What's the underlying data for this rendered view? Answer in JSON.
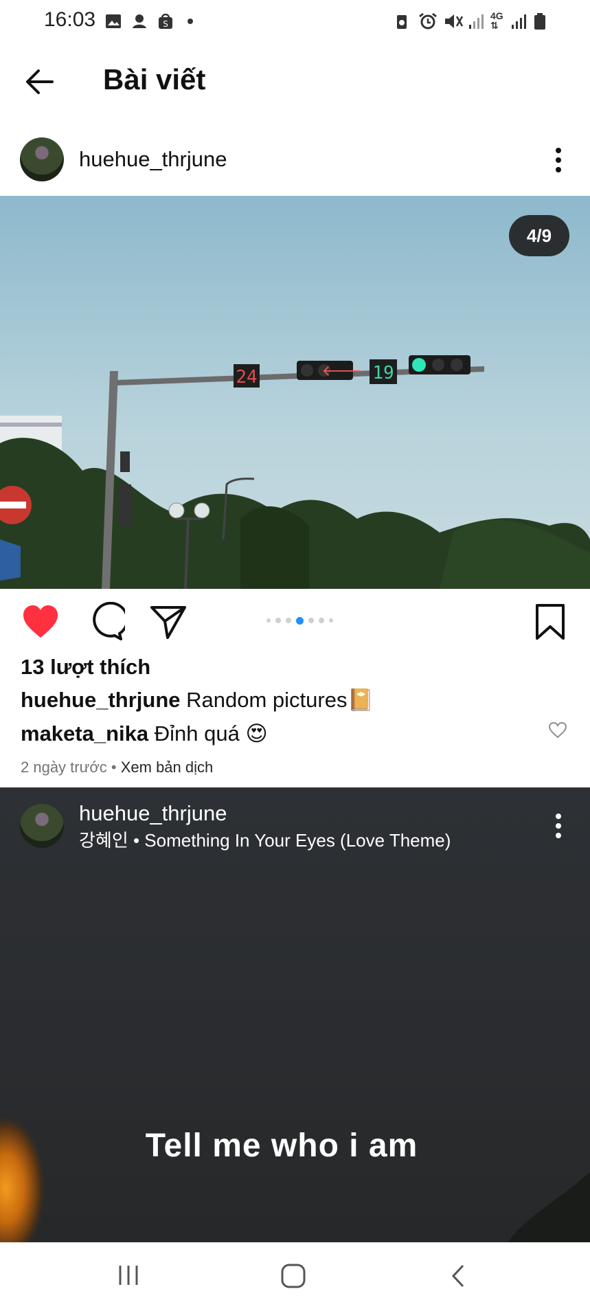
{
  "status_bar": {
    "time": "16:03"
  },
  "header": {
    "title": "Bài viết"
  },
  "post1": {
    "username": "huehue_thrjune",
    "image_counter": "4/9",
    "carousel": {
      "total": 9,
      "current": 4
    },
    "likes": "13 lượt thích",
    "caption_user": "huehue_thrjune",
    "caption_text": "Random pictures📔",
    "comment_user": "maketa_nika",
    "comment_text": "Đỉnh quá 😍",
    "time_ago": "2 ngày trước",
    "separator": "•",
    "translate": "Xem bản dịch",
    "sign_left": "24",
    "sign_right": "19"
  },
  "post2": {
    "username": "huehue_thrjune",
    "song": "강혜인 • Something In Your Eyes (Love Theme)",
    "overlay_text": "Tell me who i am"
  },
  "colors": {
    "like_red": "#ff3040",
    "dot_active": "#1f8fff",
    "counter_bg": "#2a2e30"
  }
}
